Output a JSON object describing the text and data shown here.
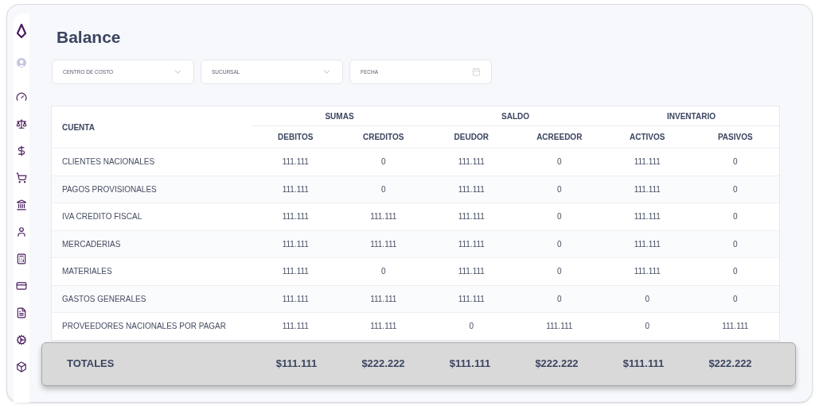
{
  "title": "Balance",
  "filters": [
    {
      "kind": "select",
      "placeholder": "CENTRO DE COSTO"
    },
    {
      "kind": "select",
      "placeholder": "SUCURSAL"
    },
    {
      "kind": "date",
      "placeholder": "FECHA"
    }
  ],
  "table": {
    "first_column": "CUENTA",
    "groups": [
      {
        "label": "SUMAS"
      },
      {
        "label": "SALDO"
      },
      {
        "label": "INVENTARIO"
      }
    ],
    "columns": [
      "DEBITOS",
      "CREDITOS",
      "DEUDOR",
      "ACREEDOR",
      "ACTIVOS",
      "PASIVOS"
    ],
    "rows": [
      {
        "account": "CLIENTES NACIONALES",
        "values": [
          "111.111",
          "0",
          "111.111",
          "0",
          "111.111",
          "0"
        ]
      },
      {
        "account": "PAGOS PROVISIONALES",
        "values": [
          "111.111",
          "0",
          "111.111",
          "0",
          "111.111",
          "0"
        ]
      },
      {
        "account": "IVA CREDITO FISCAL",
        "values": [
          "111.111",
          "111.111",
          "111.111",
          "0",
          "111.111",
          "0"
        ]
      },
      {
        "account": "MERCADERIAS",
        "values": [
          "111.111",
          "111.111",
          "111.111",
          "0",
          "111.111",
          "0"
        ]
      },
      {
        "account": "MATERIALES",
        "values": [
          "111.111",
          "0",
          "111.111",
          "0",
          "111.111",
          "0"
        ]
      },
      {
        "account": "GASTOS GENERALES",
        "values": [
          "111.111",
          "111.111",
          "111.111",
          "0",
          "0",
          "0"
        ]
      },
      {
        "account": "PROVEEDORES NACIONALES POR PAGAR",
        "values": [
          "111.111",
          "111.111",
          "0",
          "111.111",
          "0",
          "111.111"
        ]
      }
    ]
  },
  "totals": {
    "label": "TOTALES",
    "values": [
      "$111.111",
      "$222.222",
      "$111.111",
      "$222.222",
      "$111.111",
      "$222.222"
    ]
  }
}
